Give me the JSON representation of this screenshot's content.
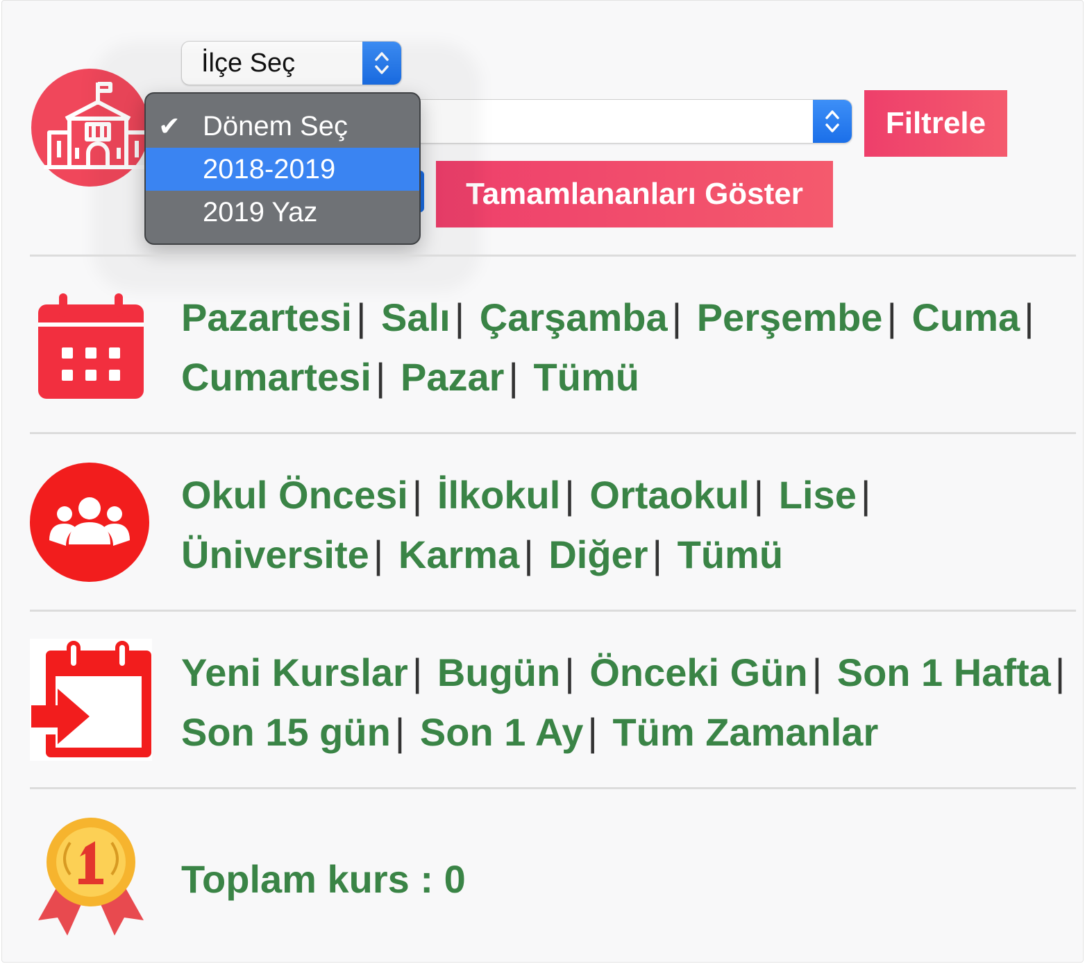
{
  "filters": {
    "district_select": {
      "value": "İlçe Seç"
    },
    "period_select": {
      "value": "",
      "options": [
        {
          "label": "Dönem Seç",
          "checked": true
        },
        {
          "label": "2018-2019",
          "highlighted": true
        },
        {
          "label": "2019 Yaz"
        }
      ]
    },
    "filter_button": "Filtrele",
    "show_completed_button": "Tamamlananları Göster",
    "icon": "school-building-icon"
  },
  "days": {
    "icon": "calendar-icon",
    "links": [
      "Pazartesi",
      "Salı",
      "Çarşamba",
      "Perşembe",
      "Cuma",
      "Cumartesi",
      "Pazar",
      "Tümü"
    ]
  },
  "levels": {
    "icon": "group-users-icon",
    "links": [
      "Okul Öncesi",
      "İlkokul",
      "Ortaokul",
      "Lise",
      "Üniversite",
      "Karma",
      "Diğer",
      "Tümü"
    ]
  },
  "new_courses": {
    "icon": "calendar-enter-icon",
    "links": [
      "Yeni Kurslar",
      "Bugün",
      "Önceki Gün",
      "Son 1 Hafta",
      "Son 15 gün",
      "Son 1 Ay",
      "Tüm Zamanlar"
    ]
  },
  "total": {
    "icon": "gold-medal-icon",
    "text": "Toplam kurs : 0"
  },
  "colors": {
    "accent_red": "#f22f3f",
    "link_green": "#3a8446",
    "button_pink": "#ef4669",
    "select_blue": "#1b6fe9"
  }
}
